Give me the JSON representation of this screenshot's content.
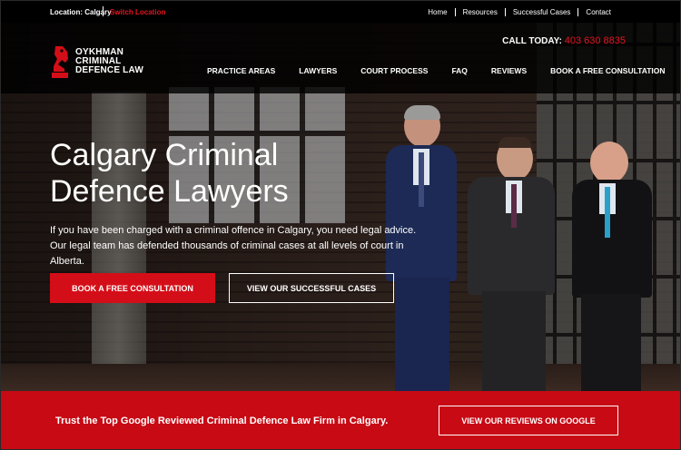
{
  "topbar": {
    "location": "Location: Calgary",
    "switch_location": "Switch Location",
    "links": [
      "Home",
      "Resources",
      "Successful Cases",
      "Contact"
    ]
  },
  "header": {
    "logo_lines": [
      "OYKHMAN",
      "CRIMINAL",
      "DEFENCE LAW"
    ],
    "call_label": "CALL TODAY:",
    "call_number": "403 630 8835",
    "nav": [
      "PRACTICE AREAS",
      "LAWYERS",
      "COURT PROCESS",
      "FAQ",
      "REVIEWS",
      "BOOK A FREE CONSULTATION"
    ]
  },
  "hero": {
    "title_line1": "Calgary Criminal",
    "title_line2": "Defence Lawyers",
    "lede": "If you have been charged with a criminal offence in Calgary, you need legal advice. Our legal team has defended thousands of criminal cases at all levels of court in Alberta.",
    "cta_primary": "BOOK A FREE CONSULTATION",
    "cta_secondary": "VIEW OUR SUCCESSFUL CASES"
  },
  "band": {
    "text": "Trust the Top Google Reviewed Criminal Defence Law Firm in Calgary.",
    "cta": "VIEW OUR REVIEWS ON GOOGLE"
  },
  "colors": {
    "accent": "#d40e18",
    "band": "#c70a14",
    "header_bg": "#000000"
  },
  "icons": {
    "logo": "chess-knight-icon"
  }
}
